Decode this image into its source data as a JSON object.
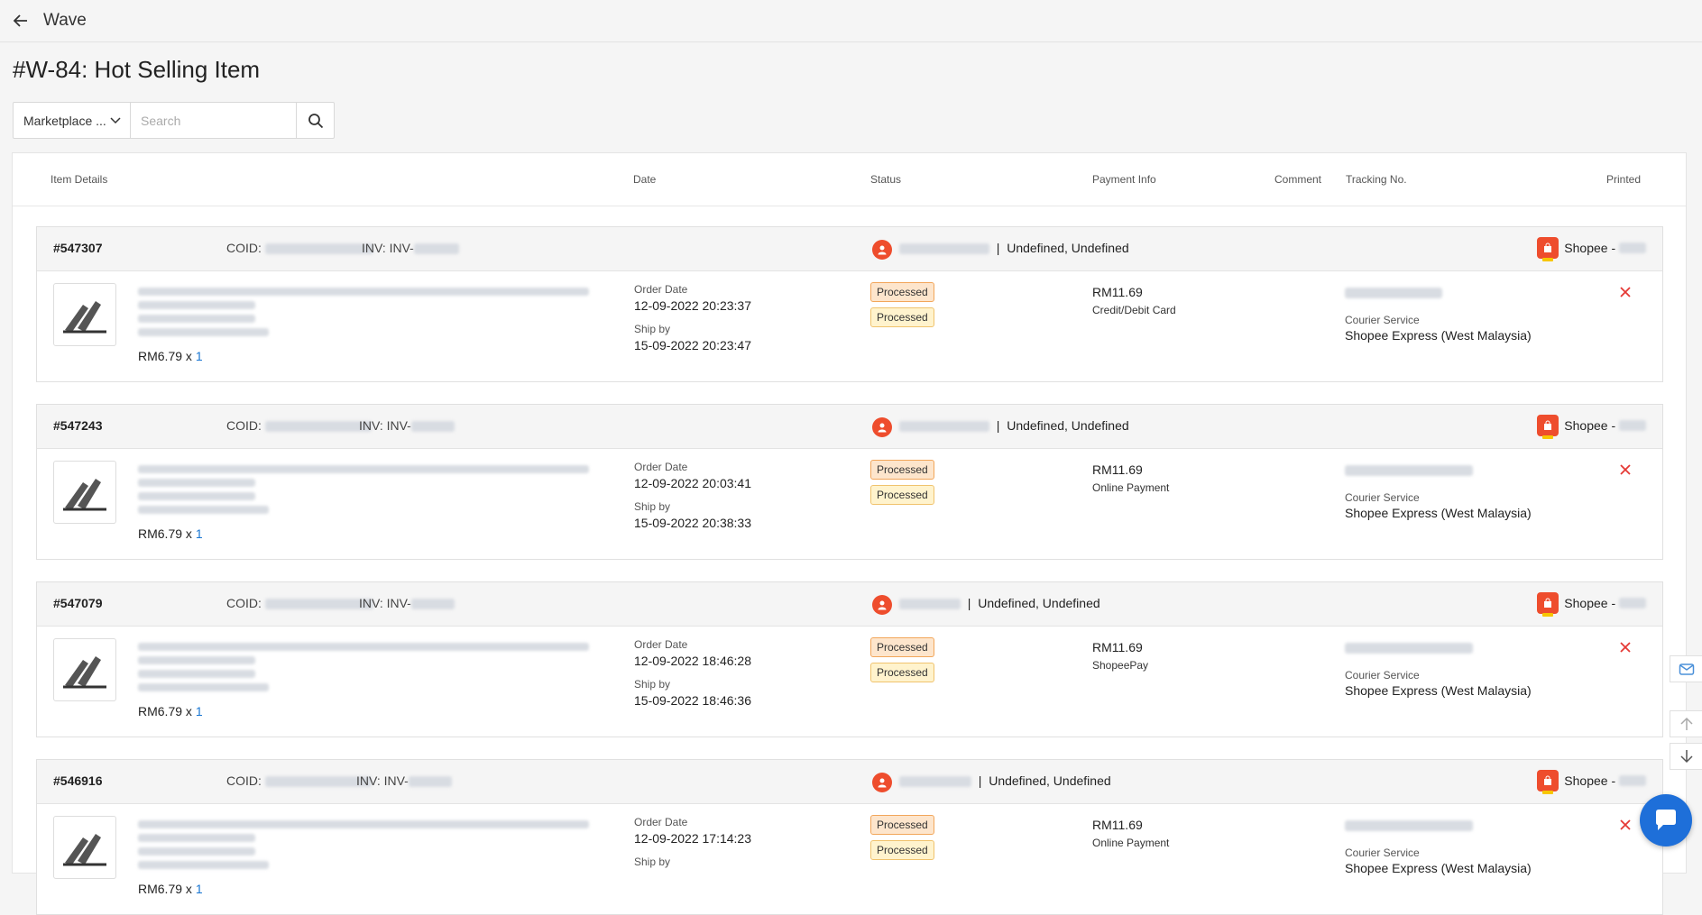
{
  "app": {
    "title": "Wave"
  },
  "page": {
    "title": "#W-84: Hot Selling Item"
  },
  "filters": {
    "marketplace_label": "Marketplace ...",
    "search_placeholder": "Search"
  },
  "columns": [
    "Item Details",
    "Date",
    "Status",
    "Payment Info",
    "Comment",
    "Tracking No.",
    "Printed"
  ],
  "orders": [
    {
      "id": "#547307",
      "coid_label": "COID:",
      "inv_label": "INV:",
      "inv_prefix": "INV-",
      "location": "Undefined, Undefined",
      "shop": "Shopee -",
      "price": "RM6.79 x",
      "qty": "1",
      "order_date_label": "Order Date",
      "order_date": "12-09-2022 20:23:37",
      "ship_by_label": "Ship by",
      "ship_by": "15-09-2022 20:23:47",
      "status": [
        "Processed",
        "Processed"
      ],
      "amount": "RM11.69",
      "method": "Credit/Debit Card",
      "courier_label": "Courier Service",
      "courier": "Shopee Express (West Malaysia)"
    },
    {
      "id": "#547243",
      "coid_label": "COID:",
      "inv_label": "INV:",
      "inv_prefix": "INV-",
      "location": "Undefined, Undefined",
      "shop": "Shopee -",
      "price": "RM6.79 x",
      "qty": "1",
      "order_date_label": "Order Date",
      "order_date": "12-09-2022 20:03:41",
      "ship_by_label": "Ship by",
      "ship_by": "15-09-2022 20:38:33",
      "status": [
        "Processed",
        "Processed"
      ],
      "amount": "RM11.69",
      "method": "Online Payment",
      "courier_label": "Courier Service",
      "courier": "Shopee Express (West Malaysia)"
    },
    {
      "id": "#547079",
      "coid_label": "COID:",
      "inv_label": "INV:",
      "inv_prefix": "INV-",
      "location": "Undefined, Undefined",
      "shop": "Shopee -",
      "price": "RM6.79 x",
      "qty": "1",
      "order_date_label": "Order Date",
      "order_date": "12-09-2022 18:46:28",
      "ship_by_label": "Ship by",
      "ship_by": "15-09-2022 18:46:36",
      "status": [
        "Processed",
        "Processed"
      ],
      "amount": "RM11.69",
      "method": "ShopeePay",
      "courier_label": "Courier Service",
      "courier": "Shopee Express (West Malaysia)"
    },
    {
      "id": "#546916",
      "coid_label": "COID:",
      "inv_label": "INV:",
      "inv_prefix": "INV-",
      "location": "Undefined, Undefined",
      "shop": "Shopee -",
      "price": "RM6.79 x",
      "qty": "1",
      "order_date_label": "Order Date",
      "order_date": "12-09-2022 17:14:23",
      "ship_by_label": "Ship by",
      "ship_by": "",
      "status": [
        "Processed",
        "Processed"
      ],
      "amount": "RM11.69",
      "method": "Online Payment",
      "courier_label": "Courier Service",
      "courier": "Shopee Express (West Malaysia)"
    }
  ],
  "colors": {
    "accent": "#1976d2",
    "shopee": "#ee4d2d",
    "cancel": "#e53935",
    "badge_processed": "#fff3cd",
    "chat": "#1e6fd9"
  },
  "icons": [
    "arrow-left-icon",
    "chevron-down-icon",
    "search-icon",
    "user-icon",
    "shopee-bag-icon",
    "close-icon",
    "mail-icon",
    "arrow-up-icon",
    "arrow-down-icon",
    "chat-icon"
  ]
}
